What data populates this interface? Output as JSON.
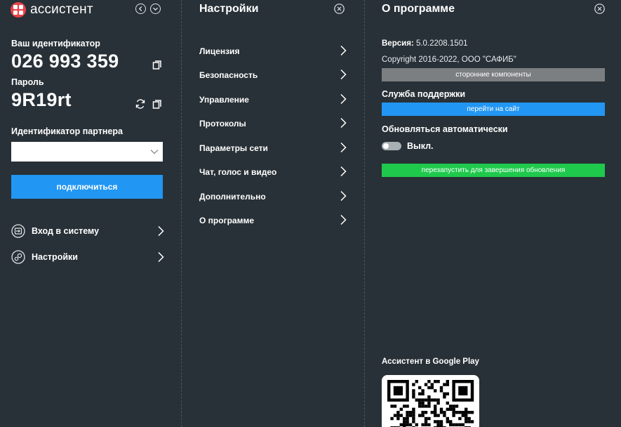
{
  "app": {
    "name": "ассистент"
  },
  "left": {
    "id_label": "Ваш идентификатор",
    "id_value": "026 993 359",
    "password_label": "Пароль",
    "password_value": "9R19rt",
    "partner_label": "Идентификатор партнера",
    "partner_value": "",
    "connect_label": "подключиться",
    "nav": [
      {
        "label": "Вход в систему",
        "icon": "login-icon"
      },
      {
        "label": "Настройки",
        "icon": "settings-icon"
      }
    ]
  },
  "settings": {
    "title": "Настройки",
    "items": [
      "Лицензия",
      "Безопасность",
      "Управление",
      "Протоколы",
      "Параметры сети",
      "Чат, голос и видео",
      "Дополнительно",
      "О программе"
    ]
  },
  "about": {
    "title": "О программе",
    "version_label": "Версия:",
    "version_value": "5.0.2208.1501",
    "copyright": "Copyright 2016-2022, ООО \"САФИБ\"",
    "third_party_label": "сторонние компоненты",
    "support_label": "Служба поддержки",
    "goto_site_label": "перейти на сайт",
    "auto_update_label": "Обновляться автоматически",
    "auto_update_state": "Выкл.",
    "restart_label": "перезапустить для завершения обновления",
    "google_play_label": "Ассистент в Google Play"
  },
  "colors": {
    "background": "#283137",
    "accent_blue": "#2196f3",
    "accent_green": "#1ec94c",
    "gray_button": "#7b7f82",
    "logo_red": "#e8424a"
  }
}
